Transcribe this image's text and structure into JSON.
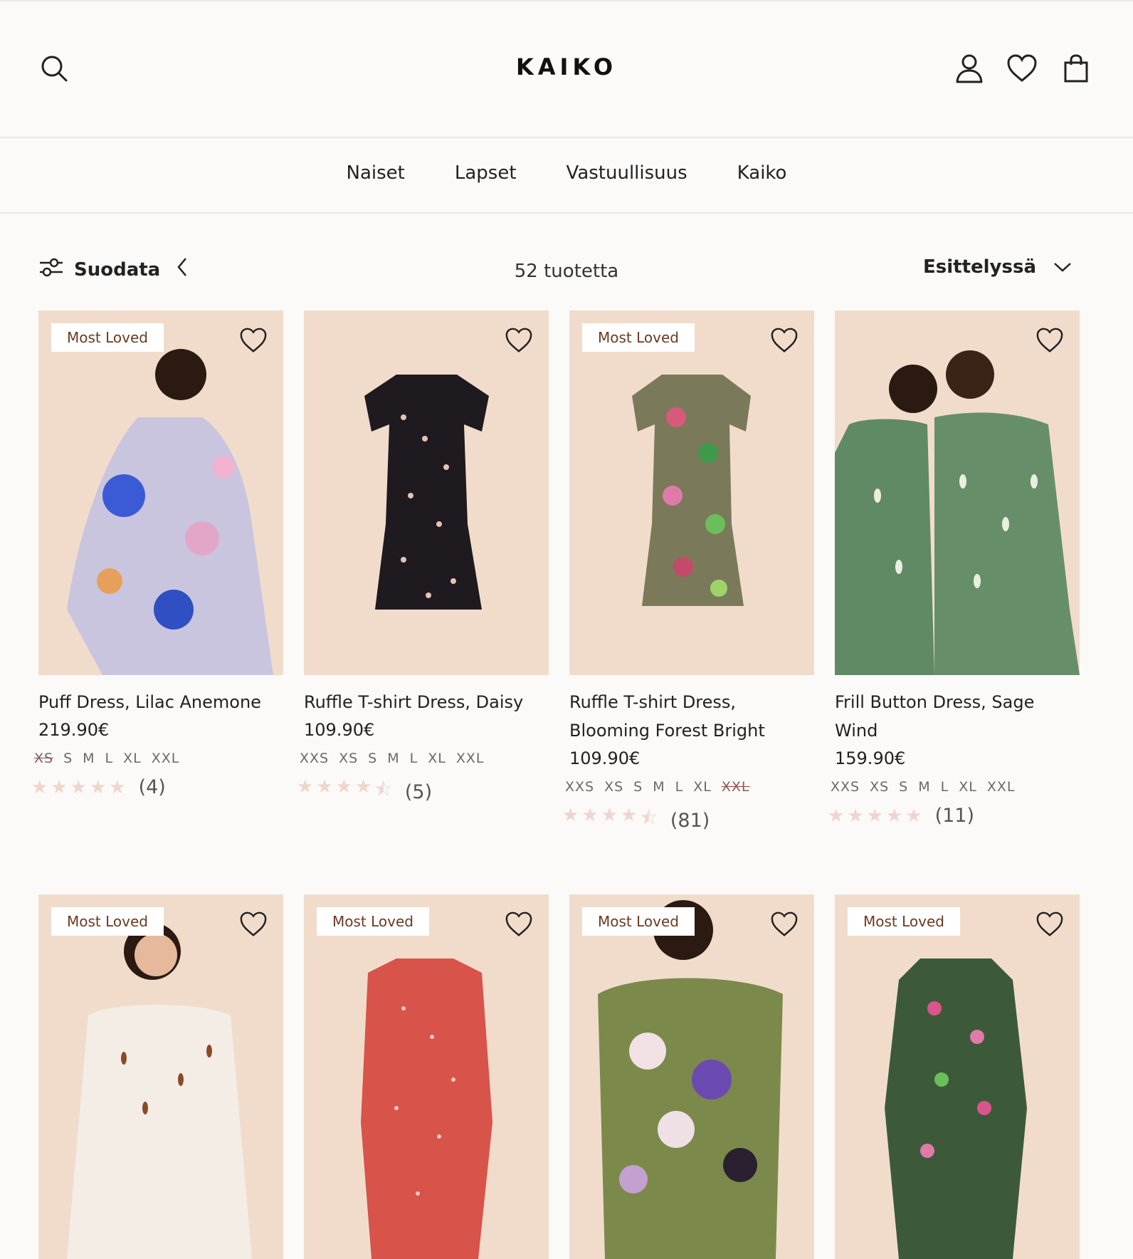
{
  "header": {
    "logo": "KAIKO"
  },
  "nav": {
    "items": [
      "Naiset",
      "Lapset",
      "Vastuullisuus",
      "Kaiko"
    ]
  },
  "toolbar": {
    "filter_label": "Suodata",
    "count_label": "52 tuotetta",
    "sort_label": "Esittelyssä"
  },
  "products": [
    {
      "badge": "Most Loved",
      "name": "Puff Dress, Lilac Anemone",
      "price": "219.90€",
      "sizes": [
        "XS",
        "S",
        "M",
        "L",
        "XL",
        "XXL"
      ],
      "sizes_out": [
        "XS"
      ],
      "rating": 5,
      "reviews": "(4)"
    },
    {
      "badge": "",
      "name": "Ruffle T-shirt Dress, Daisy",
      "price": "109.90€",
      "sizes": [
        "XXS",
        "XS",
        "S",
        "M",
        "L",
        "XL",
        "XXL"
      ],
      "sizes_out": [],
      "rating": 4.5,
      "reviews": "(5)"
    },
    {
      "badge": "Most Loved",
      "name": "Ruffle T-shirt Dress, Blooming Forest Bright",
      "price": "109.90€",
      "sizes": [
        "XXS",
        "XS",
        "S",
        "M",
        "L",
        "XL",
        "XXL"
      ],
      "sizes_out": [
        "XXL"
      ],
      "rating": 4.5,
      "reviews": "(81)"
    },
    {
      "badge": "",
      "name": "Frill Button Dress, Sage Wind",
      "price": "159.90€",
      "sizes": [
        "XXS",
        "XS",
        "S",
        "M",
        "L",
        "XL",
        "XXL"
      ],
      "sizes_out": [],
      "rating": 5,
      "reviews": "(11)"
    },
    {
      "badge": "Most Loved"
    },
    {
      "badge": "Most Loved"
    },
    {
      "badge": "Most Loved"
    },
    {
      "badge": "Most Loved"
    }
  ],
  "colors": {
    "image_bg": "#f1dccc",
    "badge_text": "#6b3a1f",
    "star": "#efd5cc"
  }
}
